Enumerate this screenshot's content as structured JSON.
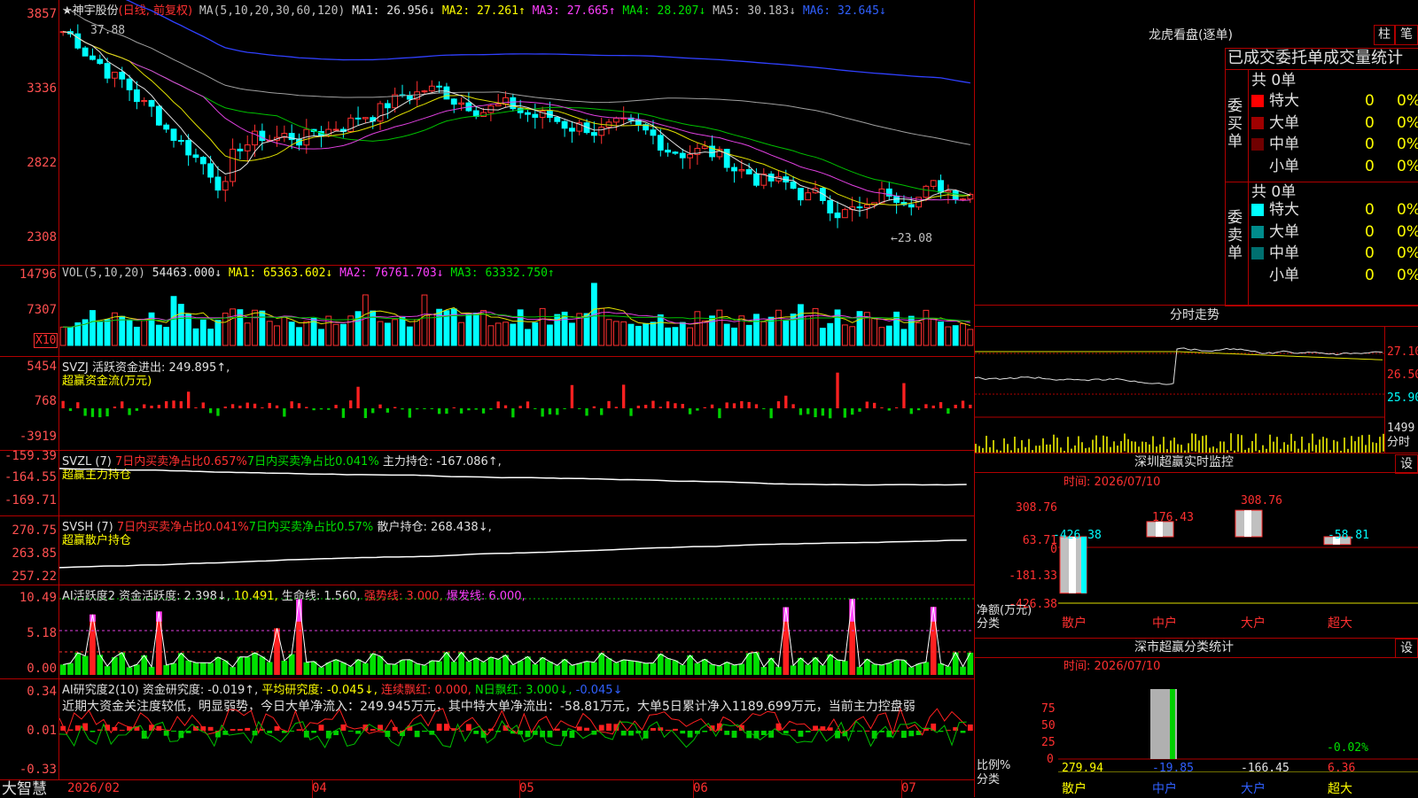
{
  "main": {
    "title": "★神宇股份",
    "mode": "(日线, 前复权)",
    "ma_label": "MA(5,10,20,30,60,120)",
    "ma1": "MA1: 26.956↓",
    "ma2": "MA2: 27.261↑",
    "ma3": "MA3: 27.665↑",
    "ma4": "MA4: 28.207↓",
    "ma5": "MA5: 30.183↓",
    "ma6": "MA6: 32.645↓",
    "y_ticks": [
      "3857",
      "3336",
      "2822",
      "2308"
    ],
    "high_marker": "37.88",
    "low_marker": "←23.08"
  },
  "vol": {
    "title": "VOL(5,10,20)",
    "value": "54463.000↓",
    "ma1": "MA1: 65363.602↓",
    "ma2": "MA2: 76761.703↓",
    "ma3": "MA3: 63332.750↑",
    "y_ticks": [
      "14796",
      "7307"
    ],
    "unit": "X10"
  },
  "svzj": {
    "title": "SVZJ  活跃资金进出: 249.895↑,",
    "subtitle": "超赢资金流(万元)",
    "y_ticks": [
      "5454",
      "768",
      "-3919"
    ]
  },
  "svzl": {
    "title": "SVZL (7)",
    "a": "7日内买卖净占比0.657%",
    "b": "7日内买卖净占比0.041%",
    "c": "主力持仓: -167.086↑,",
    "subtitle": "超赢主力持仓",
    "y_ticks": [
      "-159.39",
      "-164.55",
      "-169.71"
    ]
  },
  "svsh": {
    "title": "SVSH (7)",
    "a": "7日内买卖净占比0.041%",
    "b": "7日内买卖净占比0.57%",
    "c": "散户持仓: 268.438↓,",
    "subtitle": "超赢散户持仓",
    "y_ticks": [
      "270.75",
      "263.85",
      "257.22"
    ]
  },
  "ai1": {
    "title": "AI活跃度2",
    "a": "资金活跃度: 2.398↓,",
    "b": "10.491,",
    "c": "生命线: 1.560,",
    "d": "强势线: 3.000,",
    "e": "爆发线: 6.000,",
    "y_ticks": [
      "10.49",
      "5.18",
      "0.00"
    ]
  },
  "ai2": {
    "title": "AI研究度2(10)",
    "a": "资金研究度: -0.019↑,",
    "b": "平均研究度: -0.045↓,",
    "c": "连续飘红: 0.000,",
    "d": "N日飘红: 3.000↓,",
    "e": "-0.045↓",
    "comment": "近期大资金关注度较低，明显弱势，今日大单净流入：249.945万元，其中特大单净流出：-58.81万元，大单5日累计净入1189.699万元，当前主力控盘弱",
    "y_ticks": [
      "0.34",
      "0.01",
      "-0.33"
    ]
  },
  "xaxis": {
    "brand": "大智慧",
    "labels": [
      "2026/02",
      "04",
      "05",
      "06",
      "07"
    ]
  },
  "right": {
    "lhb_title": "龙虎看盘(逐单)",
    "btn_zhu": "柱",
    "btn_bi": "笔",
    "tabs_title": "已成交委托单成交量统计",
    "buy_label": "委买单",
    "sell_label": "委卖单",
    "buy_total": "共 0单",
    "sell_total": "共 0单",
    "buy_rows": [
      {
        "label": "特大",
        "count": "0",
        "pct": "0%",
        "color": "#ff0000"
      },
      {
        "label": "大单",
        "count": "0",
        "pct": "0%",
        "color": "#a00000"
      },
      {
        "label": "中单",
        "count": "0",
        "pct": "0%",
        "color": "#700000"
      },
      {
        "label": "小单",
        "count": "0",
        "pct": "0%",
        "color": ""
      }
    ],
    "sell_rows": [
      {
        "label": "特大",
        "count": "0",
        "pct": "0%",
        "color": "#00ffff"
      },
      {
        "label": "大单",
        "count": "0",
        "pct": "0%",
        "color": "#008c8c"
      },
      {
        "label": "中单",
        "count": "0",
        "pct": "0%",
        "color": "#007070"
      },
      {
        "label": "小单",
        "count": "0",
        "pct": "0%",
        "color": ""
      }
    ],
    "intraday_title": "分时走势",
    "intraday_ticks": [
      "27.10",
      "26.50",
      "25.90"
    ],
    "intraday_vol": "1499",
    "intraday_vol_lbl": "分时",
    "sz_monitor_title": "深圳超赢实时监控",
    "btn_set": "设",
    "monitor_time": "时间: 2026/07/10",
    "monitor_ticks": [
      "308.76",
      "63.71",
      "0",
      "-181.33",
      "-426.38"
    ],
    "monitor_ylabel": "净额(万元)",
    "monitor_xlabel": "分类",
    "monitor_cats": [
      "散户",
      "中户",
      "大户",
      "超大"
    ],
    "monitor_vals": [
      "-426.38",
      "176.43",
      "308.76",
      "-58.81"
    ],
    "class_title": "深市超赢分类统计",
    "class_time": "时间: 2026/07/10",
    "class_ticks": [
      "75",
      "50",
      "25",
      "0"
    ],
    "class_ylabel": "比例%",
    "class_xlabel": "分类",
    "class_cats": [
      "散户",
      "中户",
      "大户",
      "超大"
    ],
    "class_vals": [
      "279.94",
      "-19.85",
      "-166.45",
      "6.36"
    ],
    "class_top": "-0.02%"
  },
  "chart_data": {
    "type": "bar",
    "title": "深圳超赢实时监控",
    "ylabel": "净额(万元)",
    "categories": [
      "散户",
      "中户",
      "大户",
      "超大"
    ],
    "values": [
      -426.38,
      176.43,
      308.76,
      -58.81
    ],
    "ylim": [
      -426.38,
      308.76
    ]
  }
}
